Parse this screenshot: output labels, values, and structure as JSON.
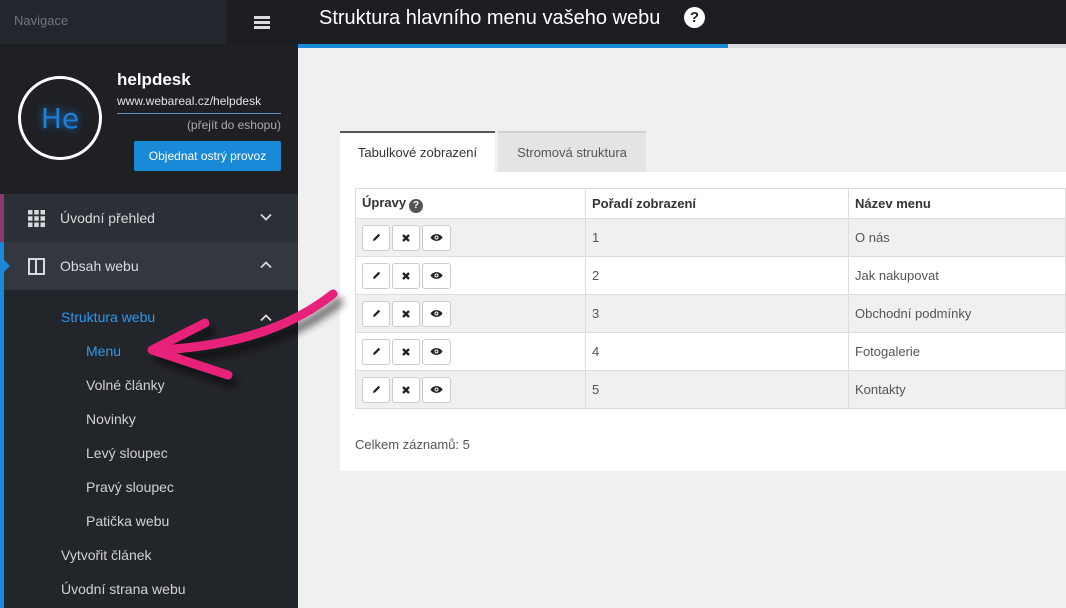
{
  "nav": {
    "title": "Navigace",
    "menu_icon": "hamburger-icon"
  },
  "profile": {
    "avatar_text": "He",
    "name": "helpdesk",
    "url": "www.webareal.cz/helpdesk",
    "shop_link": "(přejít do eshopu)",
    "order_button": "Objednat ostrý provoz"
  },
  "sidebar": {
    "items": [
      {
        "label": "Úvodní přehled",
        "icon": "grid-icon"
      },
      {
        "label": "Obsah webu",
        "icon": "columns-icon"
      }
    ],
    "submenu": {
      "parent": "Struktura webu",
      "children": [
        "Menu",
        "Volné články",
        "Novinky",
        "Levý sloupec",
        "Pravý sloupec",
        "Patička webu"
      ],
      "after": [
        "Vytvořit článek",
        "Úvodní strana webu"
      ]
    }
  },
  "header": {
    "title": "Struktura hlavního menu vašeho webu",
    "help_icon": "question-icon"
  },
  "progress": {
    "value": 0.56
  },
  "tabs": [
    "Tabulkové zobrazení",
    "Stromová struktura"
  ],
  "table": {
    "headers": [
      "Úpravy",
      "Pořadí zobrazení",
      "Název menu"
    ],
    "rows": [
      {
        "order": "1",
        "name": "O nás"
      },
      {
        "order": "2",
        "name": "Jak nakupovat"
      },
      {
        "order": "3",
        "name": "Obchodní podmínky"
      },
      {
        "order": "4",
        "name": "Fotogalerie"
      },
      {
        "order": "5",
        "name": "Kontakty"
      }
    ],
    "total": "Celkem záznamů: 5"
  },
  "colors": {
    "accent": "#1a8ad8",
    "sidebar": "#2b2f36",
    "annotation_arrow": "#e8207a"
  }
}
